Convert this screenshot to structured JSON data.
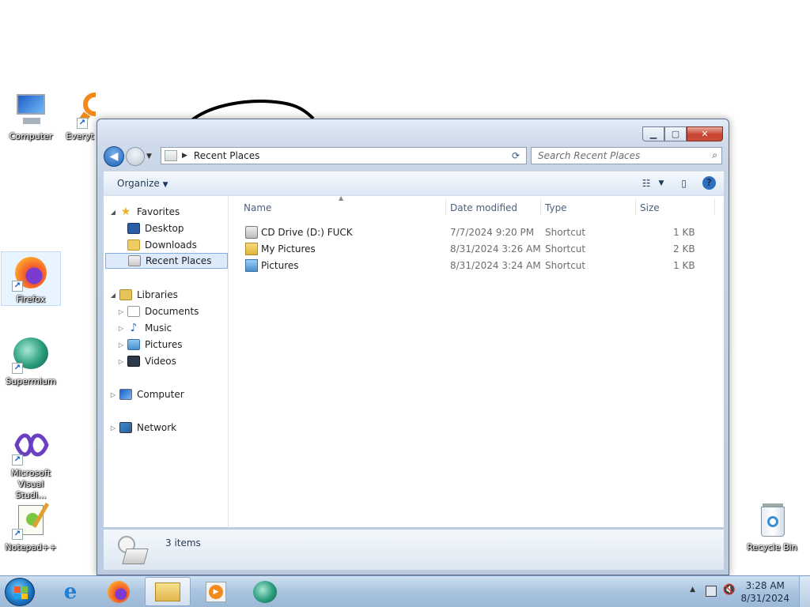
{
  "desktop": {
    "icons": [
      {
        "label": "Computer",
        "icon": "computer-icon"
      },
      {
        "label": "Everyt",
        "icon": "everything-search-icon"
      },
      {
        "label": "Firefox",
        "icon": "firefox-icon"
      },
      {
        "label": "Supermium",
        "icon": "supermium-icon"
      },
      {
        "label": "Microsoft Visual Studi...",
        "icon": "visual-studio-icon"
      },
      {
        "label": "Notepad++",
        "icon": "notepadpp-icon"
      },
      {
        "label": "Recycle Bin",
        "icon": "recycle-bin-icon"
      }
    ]
  },
  "window": {
    "address": {
      "location": "Recent Places"
    },
    "search": {
      "placeholder": "Search Recent Places"
    },
    "toolbar": {
      "organize_label": "Organize"
    },
    "nav_pane": {
      "favorites": {
        "label": "Favorites",
        "items": [
          "Desktop",
          "Downloads",
          "Recent Places"
        ],
        "selected": "Recent Places"
      },
      "libraries": {
        "label": "Libraries",
        "items": [
          "Documents",
          "Music",
          "Pictures",
          "Videos"
        ]
      },
      "computer": {
        "label": "Computer"
      },
      "network": {
        "label": "Network"
      }
    },
    "columns": [
      "Name",
      "Date modified",
      "Type",
      "Size"
    ],
    "files": [
      {
        "name": "CD Drive (D:) FUCK",
        "date": "7/7/2024 9:20 PM",
        "type": "Shortcut",
        "size": "1 KB",
        "icon": "cd-drive-icon"
      },
      {
        "name": "My Pictures",
        "date": "8/31/2024 3:26 AM",
        "type": "Shortcut",
        "size": "2 KB",
        "icon": "folder-icon"
      },
      {
        "name": "Pictures",
        "date": "8/31/2024 3:24 AM",
        "type": "Shortcut",
        "size": "1 KB",
        "icon": "pictures-library-icon"
      }
    ],
    "status": {
      "item_count": "3 items"
    }
  },
  "taskbar": {
    "pinned": [
      "internet-explorer-icon",
      "firefox-icon",
      "file-explorer-icon",
      "media-player-icon",
      "supermium-icon"
    ],
    "active": "file-explorer-icon",
    "clock": {
      "time": "3:28 AM",
      "date": "8/31/2024"
    }
  }
}
